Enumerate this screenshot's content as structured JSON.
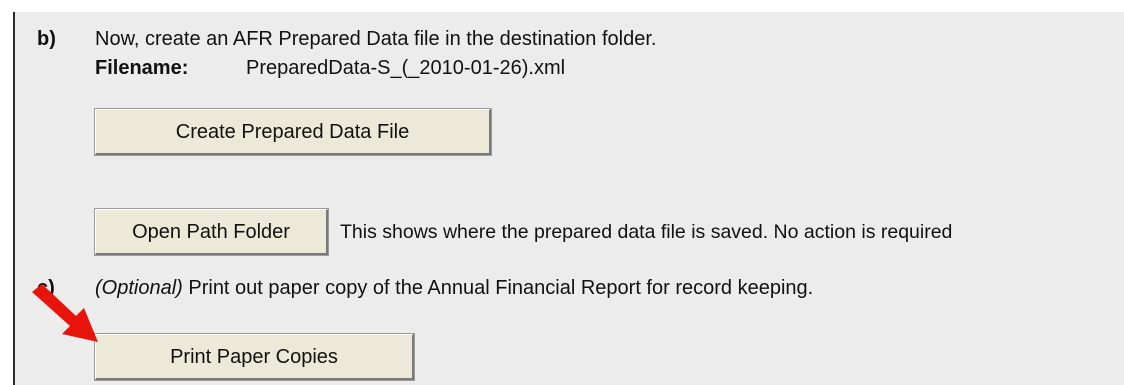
{
  "step_b": {
    "label": "b)",
    "instruction": "Now, create an AFR Prepared Data file in the destination folder.",
    "filename_label": "Filename:",
    "filename_value": "PreparedData-S_(_2010-01-26).xml",
    "create_button": "Create Prepared Data File",
    "open_folder_button": "Open Path Folder",
    "open_folder_note": "This shows where the prepared data file is saved.  No action is required"
  },
  "step_c": {
    "label": "c)",
    "optional_tag": "(Optional)",
    "instruction": " Print out paper copy of the Annual Financial Report for record keeping.",
    "print_button": "Print Paper Copies"
  },
  "colors": {
    "panel_background": "#ececec",
    "button_face": "#ece9d8",
    "arrow": "#e8140c"
  },
  "icons": {
    "annotation": "red-arrow-icon"
  }
}
